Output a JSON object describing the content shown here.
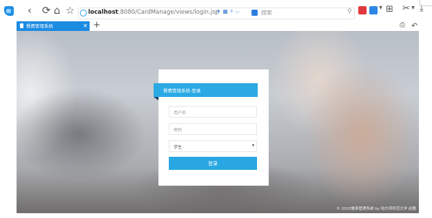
{
  "browser": {
    "address": {
      "host": "localhost",
      "rest": ":8080/CardManage/views/login.jsp",
      "search_placeholder": "搜索"
    },
    "tab": {
      "title": "餐费管理系统",
      "close": "×",
      "new": "+"
    },
    "icons": {
      "back": "‹",
      "refresh": "⟳",
      "home": "⌂",
      "star": "☆",
      "address_extras": "✈ ▦ ⚡ ⌵",
      "search_mag": "⚲",
      "ext_caret": "▾",
      "grid": "⊞",
      "cut": "✂",
      "download": "⤓",
      "save": "⎙",
      "undo": "↶"
    },
    "accent": "#1c8be2"
  },
  "login": {
    "header_title": "餐费管理系统-登录",
    "username_placeholder": "用户名",
    "password_placeholder": "密码",
    "role_selected": "学生",
    "role_caret": "▾",
    "submit_label": "登录",
    "header_color": "#2aa9e4"
  },
  "footer": {
    "copyright": "© 2020餐费管理系统 by 哈尔滨师范大学 赵鹏"
  }
}
